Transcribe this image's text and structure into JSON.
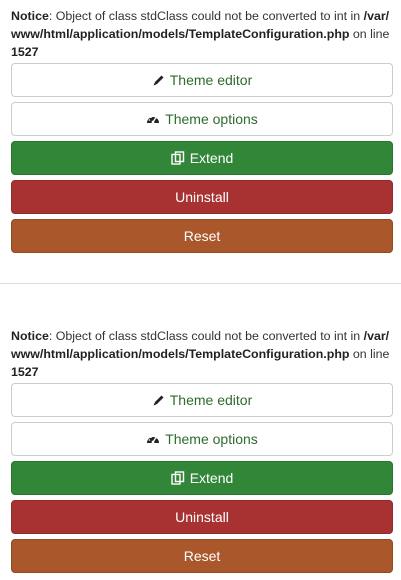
{
  "blocks": [
    {
      "notice": {
        "label": "Notice",
        "text1": ": Object of class stdClass could not be converted to int in ",
        "path": "/var/www/html/application/models/TemplateConfiguration.php",
        "text2": " on line ",
        "line": "1527"
      },
      "buttons": {
        "theme_editor": "Theme editor",
        "theme_options": "Theme options",
        "extend": "Extend",
        "uninstall": "Uninstall",
        "reset": "Reset"
      }
    },
    {
      "notice": {
        "label": "Notice",
        "text1": ": Object of class stdClass could not be converted to int in ",
        "path": "/var/www/html/application/models/TemplateConfiguration.php",
        "text2": " on line ",
        "line": "1527"
      },
      "buttons": {
        "theme_editor": "Theme editor",
        "theme_options": "Theme options",
        "extend": "Extend",
        "uninstall": "Uninstall",
        "reset": "Reset"
      }
    }
  ],
  "icons": {
    "theme_editor": "pencil-icon",
    "theme_options": "dashboard-icon",
    "extend": "copy-icon"
  },
  "colors": {
    "extend": "#328637",
    "uninstall": "#a83232",
    "reset": "#a9572b",
    "outline_text": "#2e6b2e"
  }
}
